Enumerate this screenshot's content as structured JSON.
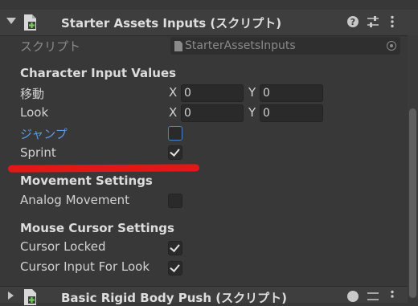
{
  "component": {
    "title": "Starter Assets Inputs (スクリプト)",
    "icon": "script-icon",
    "header_icons": [
      "help-icon",
      "preset-icon",
      "more-icon"
    ]
  },
  "script": {
    "label": "スクリプト",
    "value": "StarterAssetsInputs"
  },
  "sections": {
    "character_input": {
      "header": "Character Input Values",
      "move": {
        "label": "移動",
        "x_label": "X",
        "x": "0",
        "y_label": "Y",
        "y": "0"
      },
      "look": {
        "label": "Look",
        "x_label": "X",
        "x": "0",
        "y_label": "Y",
        "y": "0"
      },
      "jump": {
        "label": "ジャンプ",
        "checked": false
      },
      "sprint": {
        "label": "Sprint",
        "checked": true
      }
    },
    "movement": {
      "header": "Movement Settings",
      "analog": {
        "label": "Analog Movement",
        "checked": false
      }
    },
    "mouse_cursor": {
      "header": "Mouse Cursor Settings",
      "locked": {
        "label": "Cursor Locked",
        "checked": true
      },
      "input_for_look": {
        "label": "Cursor Input For Look",
        "checked": true
      }
    }
  },
  "next_component": {
    "title": "Basic Rigid Body Push (スクリプト)"
  },
  "colors": {
    "background": "#383838",
    "highlight_label": "#5d9ae0",
    "annotation": "#e21818"
  }
}
